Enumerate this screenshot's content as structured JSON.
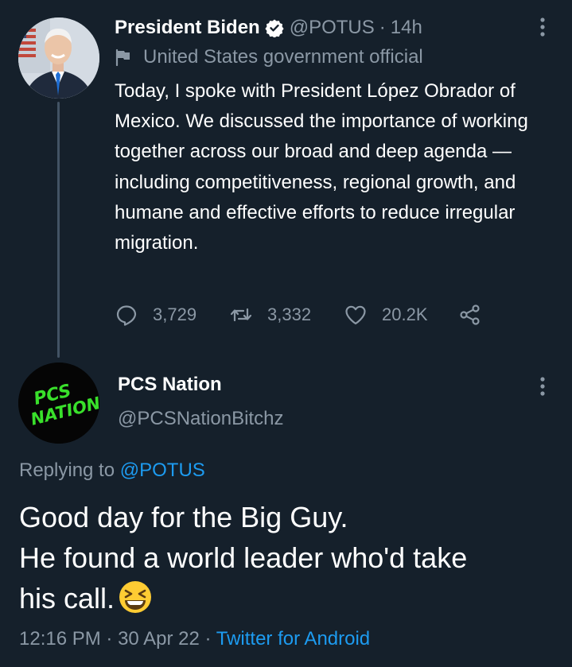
{
  "original_tweet": {
    "author_name": "President Biden",
    "handle": "@POTUS",
    "separator": "·",
    "time_ago": "14h",
    "label": "United States government official",
    "text": "Today, I spoke with President López Obrador of Mexico. We discussed the importance of working together across our broad and deep agenda — including competitiveness, regional growth, and humane and effective efforts to reduce irregular migration.",
    "stats": {
      "replies": "3,729",
      "retweets": "3,332",
      "likes": "20.2K"
    },
    "icons": [
      "verified-badge-icon",
      "flag-icon",
      "more-icon",
      "reply-icon",
      "retweet-icon",
      "like-icon",
      "share-icon"
    ]
  },
  "reply_tweet": {
    "author_name": "PCS Nation",
    "handle": "@PCSNationBitchz",
    "avatar_text_line1": "PCS",
    "avatar_text_line2": "NATION",
    "replying_prefix": "Replying to",
    "replying_to": "@POTUS",
    "text_line1": "Good day for the Big Guy.",
    "text_line2": "He found a world leader who'd take",
    "text_line3": "his call.",
    "emoji": "grinning-squinting-face",
    "time": "12:16 PM",
    "date": "30 Apr 22",
    "meta_sep": "·",
    "source": "Twitter for Android"
  },
  "colors": {
    "background": "#15202b",
    "text": "#ffffff",
    "muted": "#8b98a5",
    "accent": "#1d9bf0",
    "thread_line": "#425364",
    "avatar_logo": "#39e02b"
  }
}
